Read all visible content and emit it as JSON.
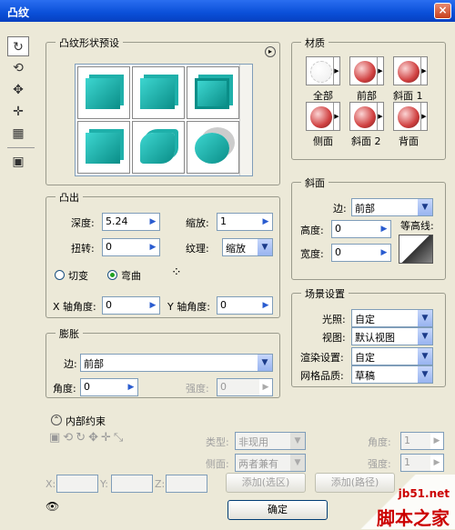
{
  "window": {
    "title": "凸纹",
    "close": "×"
  },
  "tools": [
    "bevel-icon",
    "rotate-icon",
    "move-icon",
    "scale-icon",
    "texture-icon",
    "object-icon"
  ],
  "preset": {
    "title": "凸纹形状预设",
    "menu": "▸"
  },
  "material": {
    "title": "材质",
    "items": [
      "全部",
      "前部",
      "斜面 1",
      "侧面",
      "斜面 2",
      "背面"
    ]
  },
  "extrude": {
    "title": "凸出",
    "depth_label": "深度:",
    "depth": "5.24",
    "scale_label": "缩放:",
    "scale": "1",
    "twist_label": "扭转:",
    "twist": "0",
    "texture_label": "纹理:",
    "texture": "缩放",
    "radio1": "切变",
    "radio2": "弯曲",
    "xangle_label": "X 轴角度:",
    "xangle": "0",
    "yangle_label": "Y 轴角度:",
    "yangle": "0"
  },
  "bevel": {
    "title": "斜面",
    "side_label": "边:",
    "side": "前部",
    "height_label": "高度:",
    "height": "0",
    "width_label": "宽度:",
    "width": "0",
    "contour_label": "等高线:"
  },
  "inflate": {
    "title": "膨胀",
    "side_label": "边:",
    "side": "前部",
    "angle_label": "角度:",
    "angle": "0",
    "strength_label": "强度:",
    "strength": "0"
  },
  "scene": {
    "title": "场景设置",
    "light_label": "光照:",
    "light": "自定",
    "view_label": "视图:",
    "view": "默认视图",
    "render_label": "渲染设置:",
    "render": "自定",
    "mesh_label": "网格品质:",
    "mesh": "草稿"
  },
  "constraint": {
    "title": "内部约束",
    "type_label": "类型:",
    "type": "非现用",
    "side_label": "侧面:",
    "side": "两者兼有",
    "angle_label": "角度:",
    "angle": "1",
    "strength_label": "强度:",
    "strength": "1",
    "add_sel": "添加(选区)",
    "add_path": "添加(路径)",
    "x": "X:",
    "y": "Y:",
    "z": "Z:"
  },
  "ok": "确定",
  "watermark": {
    "site": "jb51.net",
    "brand": "脚本之家"
  }
}
